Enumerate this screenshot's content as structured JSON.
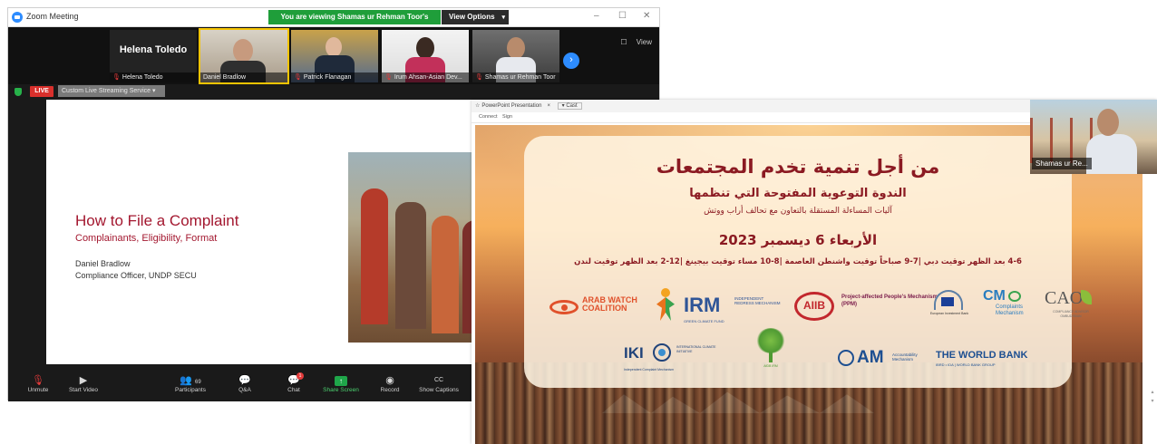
{
  "zoom": {
    "app_title": "Zoom Meeting",
    "share_banner": "You are viewing Shamas ur Rehman Toor's screen",
    "view_options": "View Options",
    "window_controls": [
      "–",
      "☐",
      "✕"
    ],
    "strip_right": [
      "☐",
      "View"
    ],
    "thumbnails": [
      {
        "big_name": "Helena Toledo",
        "label": "Helena Toledo",
        "muted": true
      },
      {
        "label": "Daniel Bradlow",
        "muted": false
      },
      {
        "label": "Patrick Flanagan",
        "muted": true
      },
      {
        "label": "Irum Ahsan-Asian Dev...",
        "muted": true
      },
      {
        "label": "Shamas ur Rehman Toor",
        "muted": true
      }
    ],
    "live_badge": "LIVE",
    "stream_select": "Custom Live Streaming Service",
    "slide": {
      "title": "How to File a Complaint",
      "subtitle": "Complainants, Eligibility, Format",
      "presenter": "Daniel Bradlow",
      "role": "Compliance Officer, UNDP SECU"
    },
    "toolbar": [
      {
        "icon": "mic-muted-icon",
        "glyph": "🎙",
        "label": "Unmute"
      },
      {
        "icon": "video-off-icon",
        "glyph": "▶",
        "label": "Start Video"
      },
      {
        "icon": "participants-icon",
        "glyph": "👥",
        "label": "Participants",
        "count": "69"
      },
      {
        "icon": "qa-icon",
        "glyph": "💬",
        "label": "Q&A"
      },
      {
        "icon": "chat-icon",
        "glyph": "💬",
        "label": "Chat",
        "badge": "1"
      },
      {
        "icon": "share-screen-icon",
        "glyph": "↑",
        "label": "Share Screen"
      },
      {
        "icon": "record-icon",
        "glyph": "◉",
        "label": "Record"
      },
      {
        "icon": "captions-icon",
        "glyph": "CC",
        "label": "Show Captions"
      }
    ]
  },
  "ppt": {
    "tab_title": "PowerPoint Presentation",
    "tab_extra": "Cast",
    "menu": [
      "Connect",
      "Sign"
    ],
    "arabic": {
      "title": "من أجل تنمية تخدم المجتمعات",
      "subtitle": "الندوة التوعوية المفتوحة التي تنظمها",
      "subtitle2": "آليات المساءلة المستقلة بالتعاون مع تحالف أراب ووتش",
      "date": "الأربعاء 6 ديسمبر 2023",
      "times": "4-6 بعد الظهر توقيت دبي |7-9 صباحاً توقيت واشنطن العاصمة |8-10 مساء توقيت بيجينغ |12-2 بعد الظهر توقيت لندن"
    },
    "logos": {
      "awc": "ARAB WATCH COALITION",
      "irm": "IRM",
      "irm_sub": "INDEPENDENT REDRESS MECHANISM",
      "irm_line": "GREEN CLIMATE FUND",
      "aiib": "AIIB",
      "ppm": "Project-affected People's Mechanism (PPM)",
      "eu": "European Investment Bank",
      "cm": "CM",
      "cm_sub": "Complaints Mechanism",
      "cao": "CAO",
      "cao_sub": "COMPLIANCE ADVISOR OMBUDSMAN",
      "iki": "IKI",
      "iki_sub": "INTERNATIONAL CLIMATE INITIATIVE",
      "iki_line": "Independent Complaint Mechanism",
      "tree": "AfDB IRM",
      "am": "AM",
      "am_sub": "Accountability Mechanism",
      "wb": "THE WORLD BANK",
      "wb_sub": "IBRD • IDA | WORLD BANK GROUP"
    },
    "speaker_tag": "Shamas ur Re..."
  }
}
